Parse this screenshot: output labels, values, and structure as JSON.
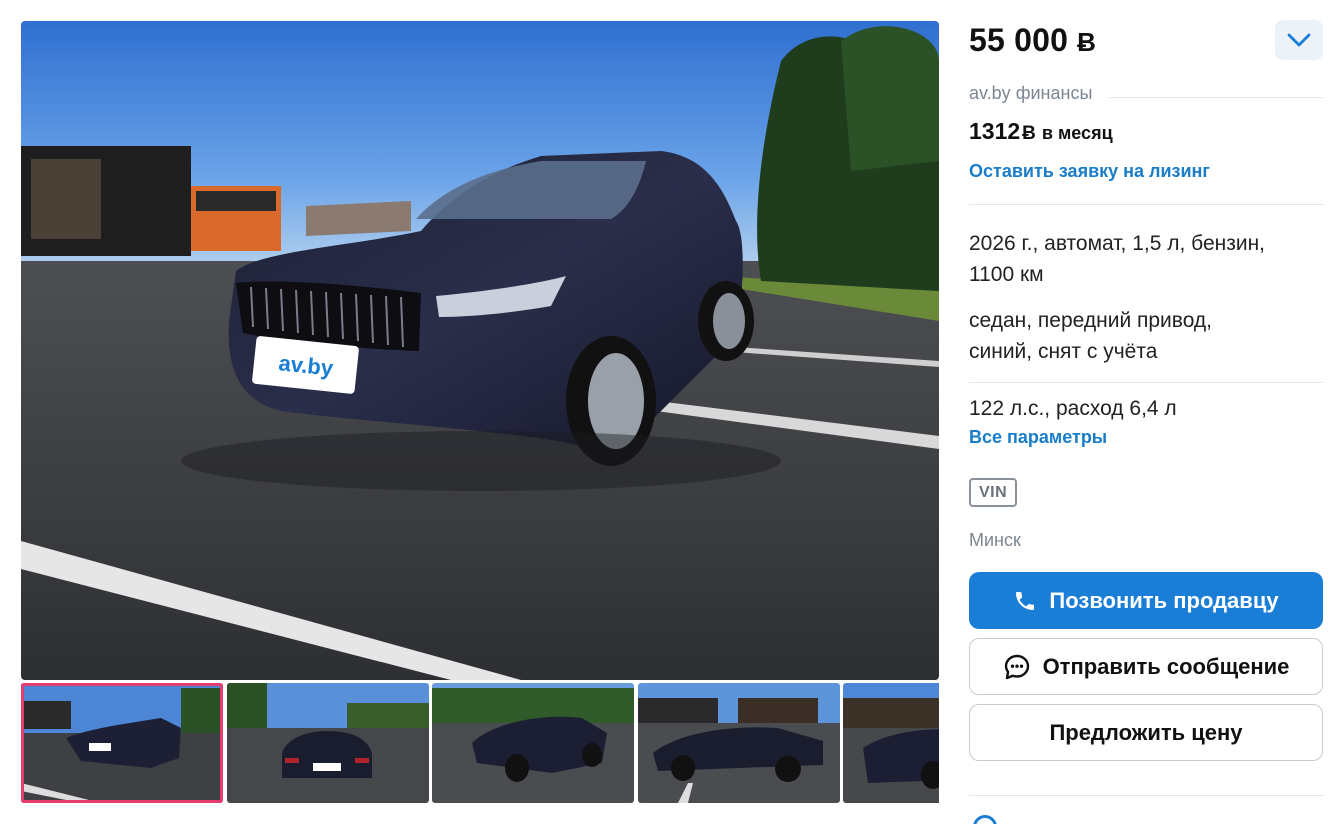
{
  "gallery": {
    "main_photo_alt": "main photo",
    "plate_text": "av.by",
    "thumbnails": [
      {
        "label": "thumbnail-1",
        "active": true
      },
      {
        "label": "thumbnail-2",
        "active": false
      },
      {
        "label": "thumbnail-3",
        "active": false
      },
      {
        "label": "thumbnail-4",
        "active": false
      },
      {
        "label": "thumbnail-5",
        "active": false
      }
    ],
    "thumbnail_plate_text": "av.by"
  },
  "listing": {
    "price": "55 000 ",
    "currency_symbol": "Ƀ",
    "finance_label": "av.by финансы",
    "monthly_amount": "1312",
    "monthly_unit": "в месяц",
    "leasing_link": "Оставить заявку на лизинг",
    "spec_line_1": "2026 г., автомат, 1,5 л, бензин,",
    "spec_line_2": "1100 км",
    "spec_line_3": "седан, передний привод,",
    "spec_line_4": "синий, снят с учёта",
    "spec_line_5": "122 л.с., расход 6,4 л",
    "all_params_link": "Все параметры",
    "vin_badge": "VIN",
    "city": "Минск"
  },
  "actions": {
    "call_label": "Позвонить продавцу",
    "message_label": "Отправить сообщение",
    "offer_label": "Предложить цену"
  },
  "colors": {
    "accent": "#1a7dd6",
    "link": "#1a7dc9",
    "active_thumb_border": "#e53d6f",
    "muted_text": "#7c8691"
  },
  "icons": {
    "expand": "chevron-down-icon",
    "call": "phone-icon",
    "message": "chat-bubble-icon"
  }
}
